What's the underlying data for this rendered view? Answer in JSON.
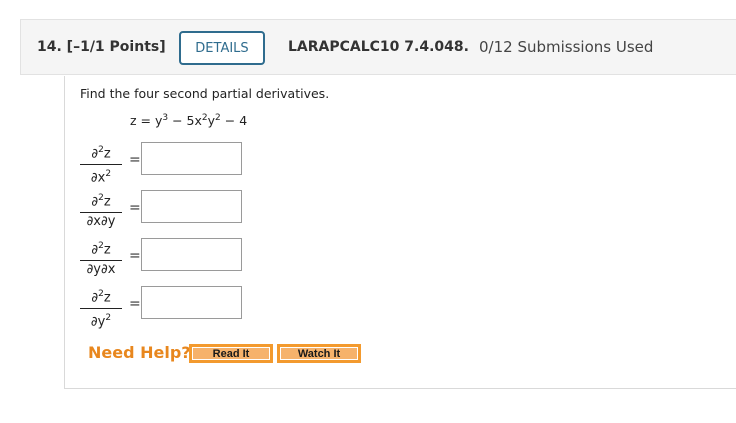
{
  "header": {
    "question_label": "14. [–1/1 Points]",
    "details_label": "DETAILS",
    "problem_code": "LARAPCALC10 7.4.048.",
    "submissions": "0/12 Submissions Used"
  },
  "problem": {
    "prompt": "Find the four second partial derivatives.",
    "equation": {
      "lhs": "z = y",
      "exp1": "3",
      "mid1": " − 5x",
      "exp2": "2",
      "mid2": "y",
      "exp3": "2",
      "tail": " − 4"
    },
    "derivatives": [
      {
        "num": "∂",
        "num_exp": "2",
        "num_var": "z",
        "den": "∂x",
        "den_exp": "2",
        "den_tail": "",
        "answer": ""
      },
      {
        "num": "∂",
        "num_exp": "2",
        "num_var": "z",
        "den": "∂x∂y",
        "den_exp": "",
        "den_tail": "",
        "answer": ""
      },
      {
        "num": "∂",
        "num_exp": "2",
        "num_var": "z",
        "den": "∂y∂x",
        "den_exp": "",
        "den_tail": "",
        "answer": ""
      },
      {
        "num": "∂",
        "num_exp": "2",
        "num_var": "z",
        "den": "∂y",
        "den_exp": "2",
        "den_tail": "",
        "answer": ""
      }
    ],
    "equals_sign": "="
  },
  "help": {
    "label": "Need Help?",
    "read_it": "Read It",
    "watch_it": "Watch It"
  },
  "colors": {
    "details_border": "#2f6c8e",
    "help_text": "#e8871e",
    "help_button": "#f6b26b"
  }
}
